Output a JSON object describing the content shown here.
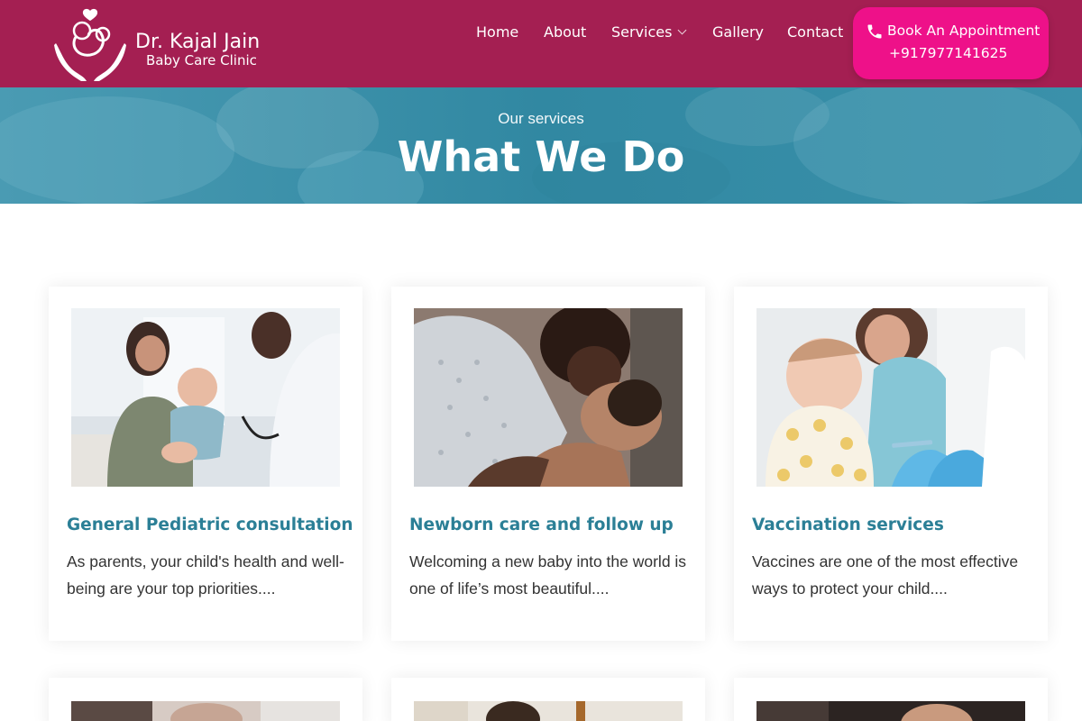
{
  "header": {
    "logo_name": "Dr. Kajal Jain",
    "logo_sub": "Baby Care Clinic",
    "nav": [
      {
        "label": "Home"
      },
      {
        "label": "About"
      },
      {
        "label": "Services"
      },
      {
        "label": "Gallery"
      },
      {
        "label": "Contact"
      }
    ],
    "cta": {
      "label": "Book An Appointment",
      "phone": "+917977141625",
      "icon": "phone-icon"
    }
  },
  "banner": {
    "overline": "Our services",
    "title": "What We Do"
  },
  "services": [
    {
      "title": "General Pediatric consultation",
      "text": "As parents, your child's health and well-being are your top priorities....",
      "image": "mother-baby-doctor-stethoscope-photo"
    },
    {
      "title": "Newborn care and follow up",
      "text": "Welcoming a new baby into the world is one of life’s most beautiful....",
      "image": "mother-holding-newborn-photo"
    },
    {
      "title": "Vaccination services",
      "text": "Vaccines are one of the most effective ways to protect your child....",
      "image": "baby-vaccination-photo"
    }
  ],
  "colors": {
    "header_bg": "#a41f52",
    "cta_bg": "#ee1189",
    "banner_bg": "#3a8fa8",
    "title_accent": "#2b7f96"
  }
}
